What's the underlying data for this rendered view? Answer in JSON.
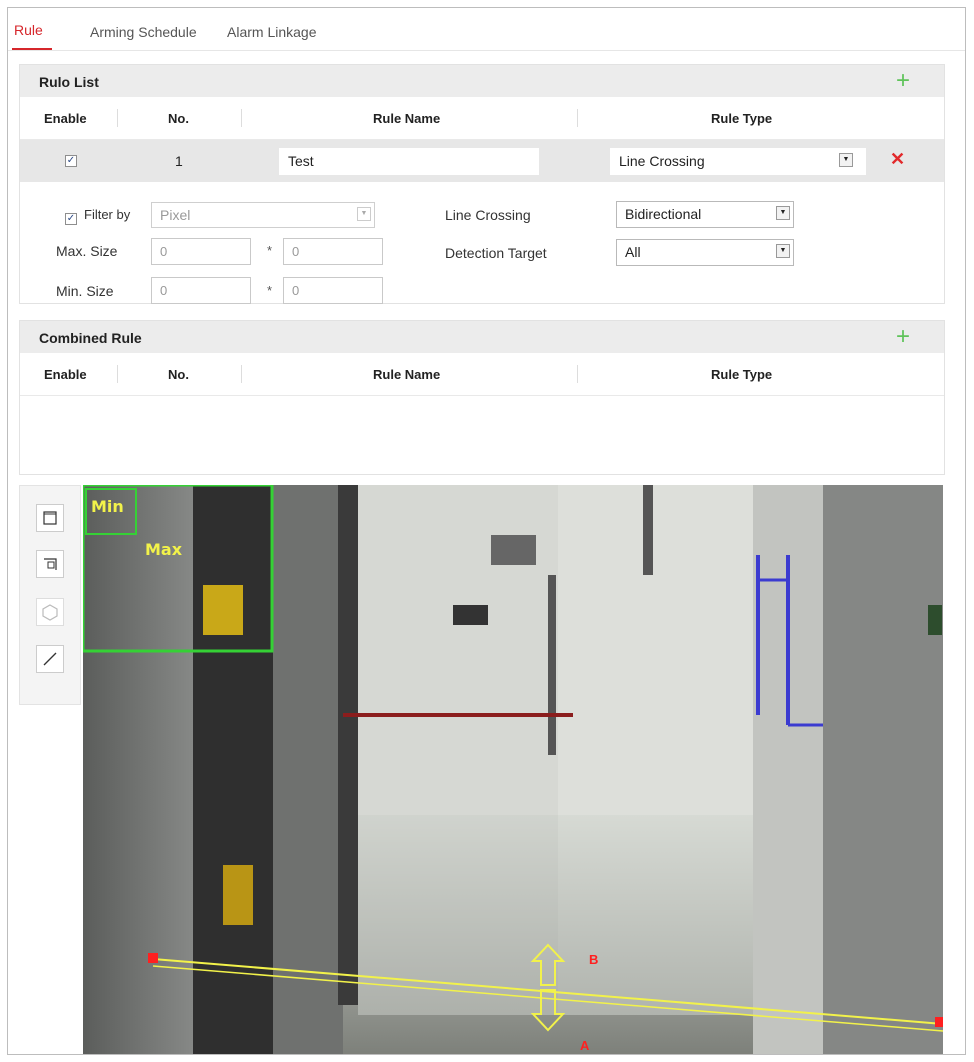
{
  "tabs": {
    "rule": "Rule",
    "arming_schedule": "Arming Schedule",
    "alarm_linkage": "Alarm Linkage"
  },
  "rule_list": {
    "title": "Rulo List",
    "columns": [
      "Enable",
      "No.",
      "Rule Name",
      "Rule Type"
    ],
    "row": {
      "enabled": true,
      "number": "1",
      "name": "Test",
      "type": "Line Crossing"
    },
    "settings": {
      "filter_by_label": "Filter by",
      "filter_by_checked": true,
      "filter_by_value": "Pixel",
      "max_size_label": "Max. Size",
      "max_w": "0",
      "max_h": "0",
      "min_size_label": "Min. Size",
      "min_w": "0",
      "min_h": "0",
      "times": "*",
      "line_crossing_label": "Line Crossing",
      "line_crossing_value": "Bidirectional",
      "detection_target_label": "Detection Target",
      "detection_target_value": "All"
    }
  },
  "combined_rule": {
    "title": "Combined Rule",
    "columns": [
      "Enable",
      "No.",
      "Rule Name",
      "Rule Type"
    ]
  },
  "video": {
    "min_label": "Min",
    "max_label": "Max",
    "line_end_a": "B",
    "line_end_b": "A"
  },
  "icons": {
    "tool_1": "draw-max-rect-icon",
    "tool_2": "draw-min-rect-icon",
    "tool_3": "polygon-icon",
    "tool_4": "line-icon",
    "add": "plus-icon",
    "delete": "close-icon"
  },
  "colors": {
    "accent_red": "#d6262b",
    "add_green": "#5fc35a",
    "overlay_green": "#35d135",
    "overlay_yellow": "#f2f24a",
    "marker_red": "#ff2020"
  }
}
